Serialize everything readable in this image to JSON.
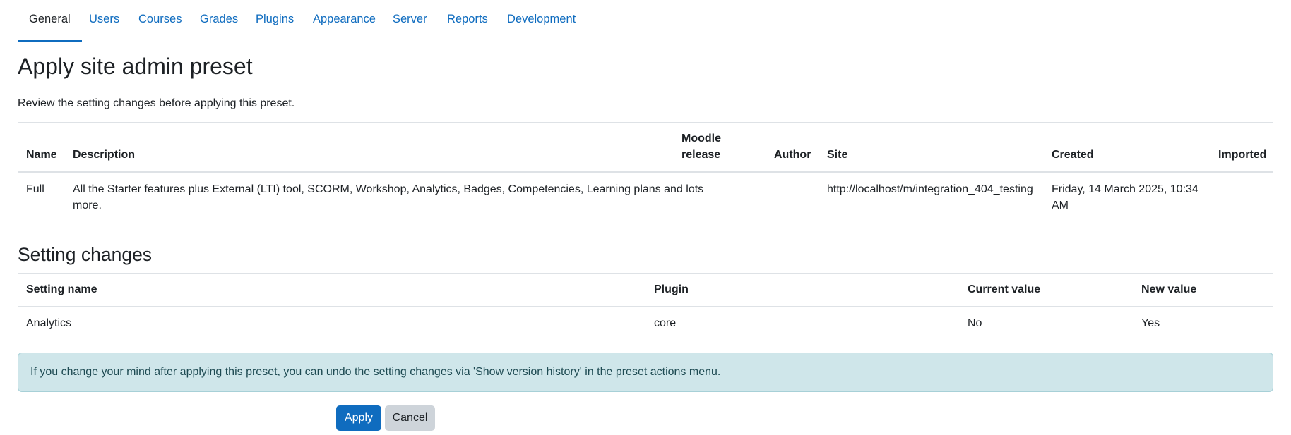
{
  "nav": {
    "tabs": [
      {
        "label": "General"
      },
      {
        "label": "Users"
      },
      {
        "label": "Courses"
      },
      {
        "label": "Grades"
      },
      {
        "label": "Plugins"
      },
      {
        "label": "Appearance"
      },
      {
        "label": "Server"
      },
      {
        "label": "Reports"
      },
      {
        "label": "Development"
      }
    ]
  },
  "page": {
    "title": "Apply site admin preset",
    "intro": "Review the setting changes before applying this preset."
  },
  "preset_table": {
    "headers": {
      "name": "Name",
      "description": "Description",
      "release_line1": "Moodle",
      "release_line2": "release",
      "author": "Author",
      "site": "Site",
      "created": "Created",
      "imported": "Imported"
    },
    "row": {
      "name": "Full",
      "description_line1": "All the Starter features plus External (LTI) tool, SCORM, Workshop, Analytics, Badges, Competencies, Learning plans and lots",
      "description_line2": "more.",
      "release": "",
      "author": "",
      "site": "http://localhost/m/integration_404_testing",
      "created_line1": "Friday, 14 March 2025, 10:34",
      "created_line2": "AM",
      "imported": ""
    }
  },
  "settings": {
    "heading": "Setting changes",
    "headers": {
      "setting_name": "Setting name",
      "plugin": "Plugin",
      "current_value": "Current value",
      "new_value": "New value"
    },
    "rows": [
      {
        "setting_name": "Analytics",
        "plugin": "core",
        "current_value": "No",
        "new_value": "Yes"
      }
    ]
  },
  "notice": "If you change your mind after applying this preset, you can undo the setting changes via 'Show version history' in the preset actions menu.",
  "actions": {
    "apply": "Apply",
    "cancel": "Cancel"
  },
  "colors": {
    "link": "#0f6cbf",
    "primary_button": "#0f6cbf",
    "secondary_button": "#ced4da",
    "alert_background": "#cfe6ea"
  }
}
